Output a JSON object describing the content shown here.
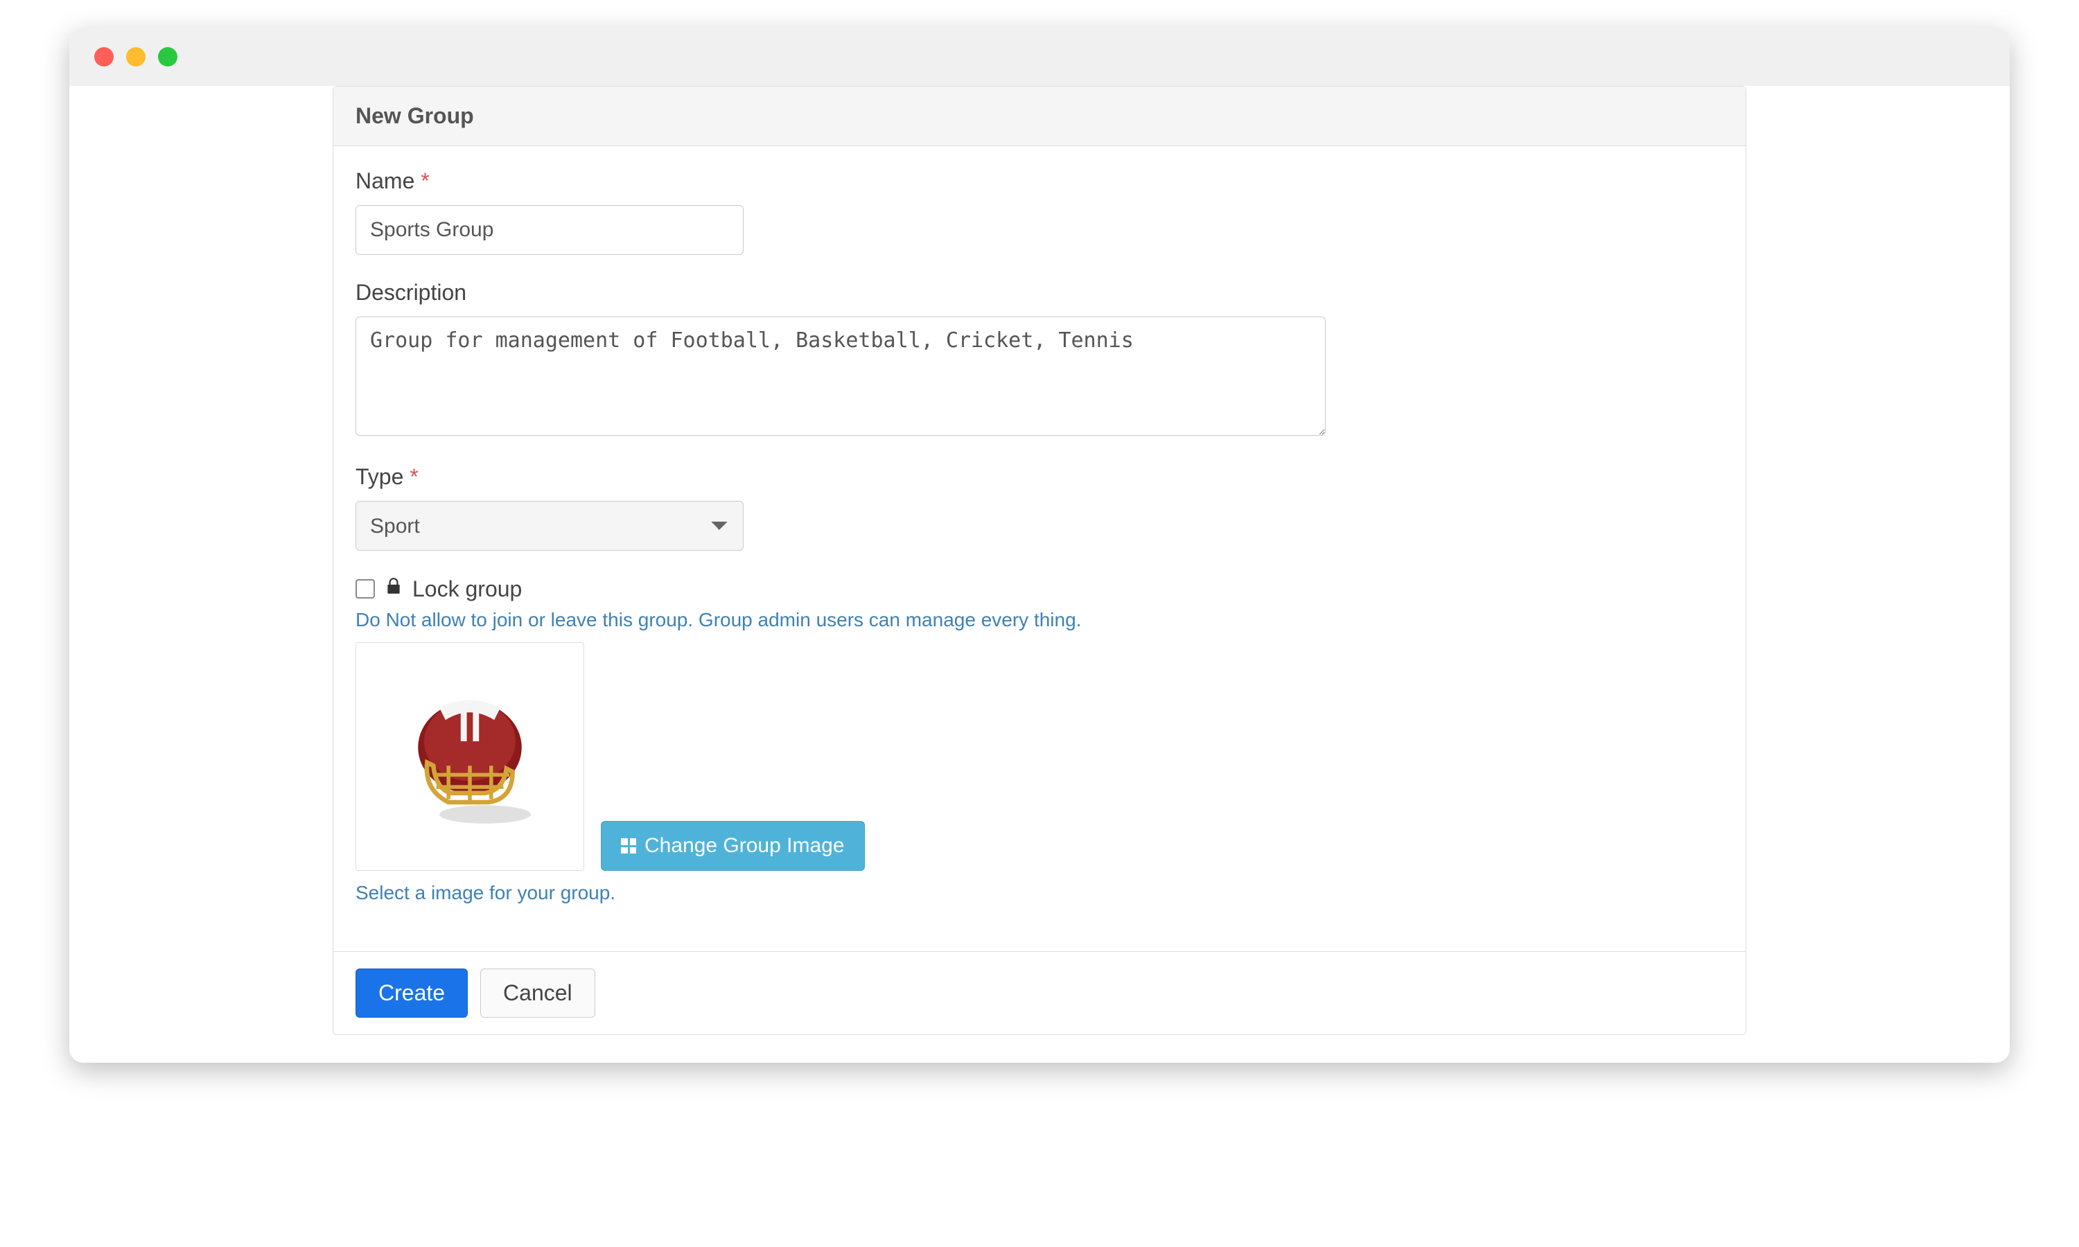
{
  "panel": {
    "title": "New Group"
  },
  "form": {
    "name_label": "Name",
    "name_value": "Sports Group",
    "description_label": "Description",
    "description_value": "Group for management of Football, Basketball, Cricket, Tennis",
    "type_label": "Type",
    "type_selected": "Sport",
    "lock_label": "Lock group",
    "lock_checked": false,
    "lock_help": "Do Not allow to join or leave this group. Group admin users can manage every thing.",
    "change_image_label": "Change Group Image",
    "image_help": "Select a image for your group.",
    "image_alt": "football-helmet"
  },
  "footer": {
    "create_label": "Create",
    "cancel_label": "Cancel"
  },
  "required_marker": "*"
}
